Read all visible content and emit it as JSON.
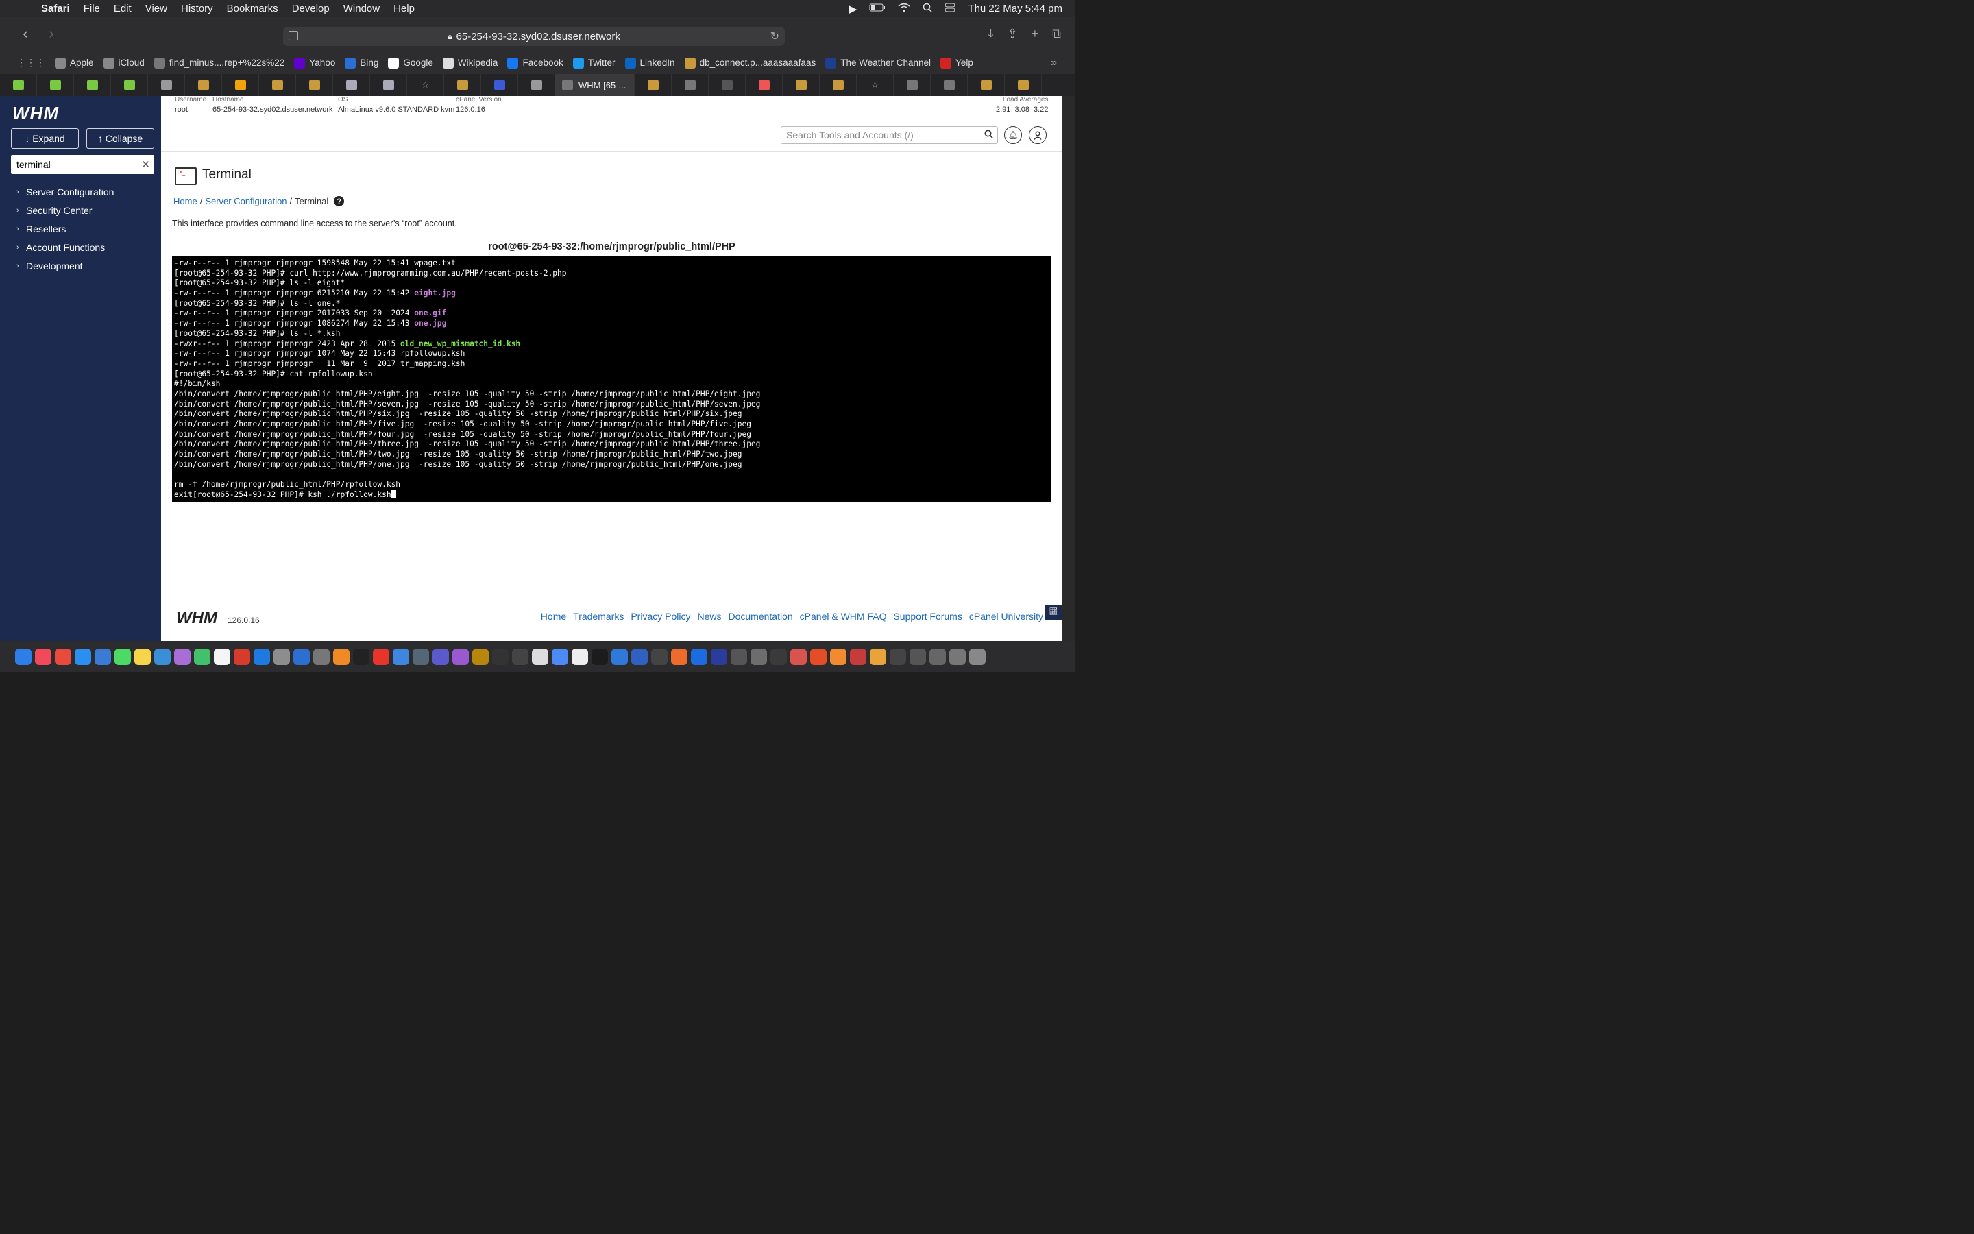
{
  "menubar": {
    "app": "Safari",
    "items": [
      "File",
      "Edit",
      "View",
      "History",
      "Bookmarks",
      "Develop",
      "Window",
      "Help"
    ],
    "clock": "Thu 22 May  5:44 pm"
  },
  "browser": {
    "url": "65-254-93-32.syd02.dsuser.network",
    "bookmarks": [
      {
        "label": "Apple",
        "icon": "apple-icon",
        "color": "#888888"
      },
      {
        "label": "iCloud",
        "icon": "apple-icon",
        "color": "#888888"
      },
      {
        "label": "find_minus....rep+%22s%22",
        "icon": "site-icon",
        "color": "#777777"
      },
      {
        "label": "Yahoo",
        "icon": "yahoo-icon",
        "color": "#6001d2"
      },
      {
        "label": "Bing",
        "icon": "bing-icon",
        "color": "#2b6fd6"
      },
      {
        "label": "Google",
        "icon": "google-icon",
        "color": "#ffffff"
      },
      {
        "label": "Wikipedia",
        "icon": "wikipedia-icon",
        "color": "#dddddd"
      },
      {
        "label": "Facebook",
        "icon": "facebook-icon",
        "color": "#1877f2"
      },
      {
        "label": "Twitter",
        "icon": "twitter-icon",
        "color": "#1d9bf0"
      },
      {
        "label": "LinkedIn",
        "icon": "linkedin-icon",
        "color": "#0a66c2"
      },
      {
        "label": "db_connect.p...aaasaaafaas",
        "icon": "site-icon",
        "color": "#c89a3c"
      },
      {
        "label": "The Weather Channel",
        "icon": "weather-icon",
        "color": "#1d3f8f"
      },
      {
        "label": "Yelp",
        "icon": "yelp-icon",
        "color": "#d32323"
      }
    ],
    "active_tab": "WHM [65-..."
  },
  "whm": {
    "logo": "WHM",
    "expand_label": "↓ Expand",
    "collapse_label": "↑ Collapse",
    "sidebar_search_value": "terminal",
    "sidebar_items": [
      "Server Configuration",
      "Security Center",
      "Resellers",
      "Account Functions",
      "Development"
    ],
    "sysinfo": {
      "username_label": "Username",
      "username": "root",
      "hostname_label": "Hostname",
      "hostname": "65-254-93-32.syd02.dsuser.network",
      "os_label": "OS",
      "os": "AlmaLinux v9.6.0 STANDARD kvm",
      "cpanel_label": "cPanel Version",
      "cpanel": "126.0.16",
      "load_label": "Load Averages",
      "load": "2.91  3.08  3.22"
    },
    "tool_search_placeholder": "Search Tools and Accounts (/)",
    "page_title": "Terminal",
    "breadcrumb": [
      "Home",
      "Server Configuration",
      "Terminal"
    ],
    "intro": "This interface provides command line access to the server’s “root” account.",
    "terminal_title": "root@65-254-93-32:/home/rjmprogr/public_html/PHP",
    "terminal_lines": [
      [
        {
          "t": "-rw-r--r-- 1 rjmprogr rjmprogr 1598548 May 22 15:41 wpage.txt"
        }
      ],
      [
        {
          "t": "[root@65-254-93-32 PHP]# curl http://www.rjmprogramming.com.au/PHP/recent-posts-2.php"
        }
      ],
      [
        {
          "t": "[root@65-254-93-32 PHP]# ls -l eight*"
        }
      ],
      [
        {
          "t": "-rw-r--r-- 1 rjmprogr rjmprogr 6215210 May 22 15:42 "
        },
        {
          "t": "eight.jpg",
          "c": "t-purple"
        }
      ],
      [
        {
          "t": "[root@65-254-93-32 PHP]# ls -l one.*"
        }
      ],
      [
        {
          "t": "-rw-r--r-- 1 rjmprogr rjmprogr 2017033 Sep 20  2024 "
        },
        {
          "t": "one.gif",
          "c": "t-purple"
        }
      ],
      [
        {
          "t": "-rw-r--r-- 1 rjmprogr rjmprogr 1086274 May 22 15:43 "
        },
        {
          "t": "one.jpg",
          "c": "t-purple"
        }
      ],
      [
        {
          "t": "[root@65-254-93-32 PHP]# ls -l *.ksh"
        }
      ],
      [
        {
          "t": "-rwxr--r-- 1 rjmprogr rjmprogr 2423 Apr 28  2015 "
        },
        {
          "t": "old_new_wp_mismatch_id.ksh",
          "c": "t-green"
        }
      ],
      [
        {
          "t": "-rw-r--r-- 1 rjmprogr rjmprogr 1074 May 22 15:43 rpfollowup.ksh"
        }
      ],
      [
        {
          "t": "-rw-r--r-- 1 rjmprogr rjmprogr   11 Mar  9  2017 tr_mapping.ksh"
        }
      ],
      [
        {
          "t": "[root@65-254-93-32 PHP]# cat rpfollowup.ksh"
        }
      ],
      [
        {
          "t": "#!/bin/ksh"
        }
      ],
      [
        {
          "t": "/bin/convert /home/rjmprogr/public_html/PHP/eight.jpg  -resize 105 -quality 50 -strip /home/rjmprogr/public_html/PHP/eight.jpeg"
        }
      ],
      [
        {
          "t": "/bin/convert /home/rjmprogr/public_html/PHP/seven.jpg  -resize 105 -quality 50 -strip /home/rjmprogr/public_html/PHP/seven.jpeg"
        }
      ],
      [
        {
          "t": "/bin/convert /home/rjmprogr/public_html/PHP/six.jpg  -resize 105 -quality 50 -strip /home/rjmprogr/public_html/PHP/six.jpeg"
        }
      ],
      [
        {
          "t": "/bin/convert /home/rjmprogr/public_html/PHP/five.jpg  -resize 105 -quality 50 -strip /home/rjmprogr/public_html/PHP/five.jpeg"
        }
      ],
      [
        {
          "t": "/bin/convert /home/rjmprogr/public_html/PHP/four.jpg  -resize 105 -quality 50 -strip /home/rjmprogr/public_html/PHP/four.jpeg"
        }
      ],
      [
        {
          "t": "/bin/convert /home/rjmprogr/public_html/PHP/three.jpg  -resize 105 -quality 50 -strip /home/rjmprogr/public_html/PHP/three.jpeg"
        }
      ],
      [
        {
          "t": "/bin/convert /home/rjmprogr/public_html/PHP/two.jpg  -resize 105 -quality 50 -strip /home/rjmprogr/public_html/PHP/two.jpeg"
        }
      ],
      [
        {
          "t": "/bin/convert /home/rjmprogr/public_html/PHP/one.jpg  -resize 105 -quality 50 -strip /home/rjmprogr/public_html/PHP/one.jpeg"
        }
      ],
      [
        {
          "t": ""
        }
      ],
      [
        {
          "t": "rm -f /home/rjmprogr/public_html/PHP/rpfollow.ksh"
        }
      ],
      [
        {
          "t": "exit[root@65-254-93-32 PHP]# ksh ./rpfollow.ksh"
        }
      ]
    ],
    "footer_logo": "WHM",
    "footer_version": "126.0.16",
    "footer_links": [
      "Home",
      "Trademarks",
      "Privacy Policy",
      "News",
      "Documentation",
      "cPanel & WHM FAQ",
      "Support Forums",
      "cPanel University"
    ]
  },
  "dock": {
    "colors": [
      "#2d7ee6",
      "#f24a5a",
      "#e84a3c",
      "#2a8ff0",
      "#3a7bd5",
      "#4cd964",
      "#f7d54a",
      "#3b8fd9",
      "#a86ed6",
      "#43c06b",
      "#f5f5f5",
      "#d73b2b",
      "#1f7ae0",
      "#8d8d8d",
      "#2c6fd1",
      "#777777",
      "#f08a24",
      "#222222",
      "#e6352b",
      "#3e86e0",
      "#556677",
      "#5a5acd",
      "#9b59d0",
      "#b8860b",
      "#333333",
      "#444444",
      "#dddddd",
      "#4c8bf5",
      "#eeeeee",
      "#1c1c1c",
      "#2f7ad8",
      "#3060c0",
      "#444444",
      "#ec6b2d",
      "#1b6ce0",
      "#2a3d9f",
      "#555555",
      "#6d6d6d",
      "#3a3a3a",
      "#d9534f",
      "#e44d26",
      "#f28b30",
      "#c63c3c",
      "#e8a33a",
      "#444444",
      "#555555",
      "#666666",
      "#777777",
      "#888888"
    ]
  }
}
